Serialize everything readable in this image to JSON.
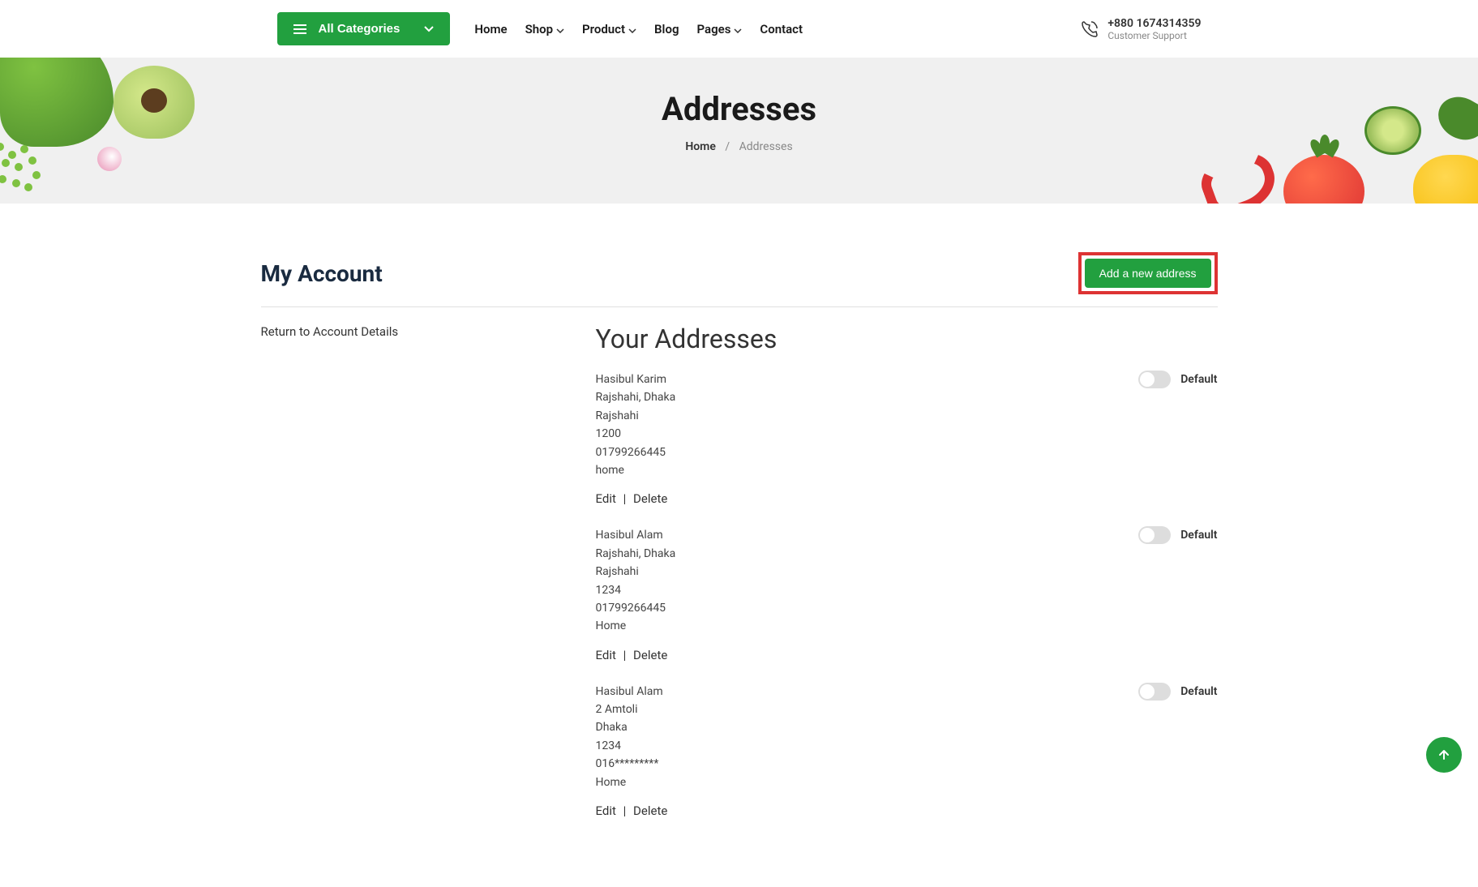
{
  "nav": {
    "categories_label": "All Categories",
    "menu": [
      {
        "label": "Home",
        "has_dropdown": false
      },
      {
        "label": "Shop",
        "has_dropdown": true
      },
      {
        "label": "Product",
        "has_dropdown": true
      },
      {
        "label": "Blog",
        "has_dropdown": false
      },
      {
        "label": "Pages",
        "has_dropdown": true
      },
      {
        "label": "Contact",
        "has_dropdown": false
      }
    ],
    "phone": "+880 1674314359",
    "support_label": "Customer Support"
  },
  "hero": {
    "title": "Addresses",
    "breadcrumb_home": "Home",
    "breadcrumb_current": "Addresses"
  },
  "account": {
    "title": "My Account",
    "add_button": "Add a new address",
    "return_link": "Return to Account Details",
    "addresses_title": "Your Addresses",
    "default_label": "Default",
    "edit_label": "Edit",
    "delete_label": "Delete",
    "addresses": [
      {
        "name": "Hasibul Karim",
        "street": "Rajshahi, Dhaka",
        "city": "Rajshahi",
        "postal": "1200",
        "phone": "01799266445",
        "type": "home"
      },
      {
        "name": "Hasibul Alam",
        "street": "Rajshahi, Dhaka",
        "city": "Rajshahi",
        "postal": "1234",
        "phone": "01799266445",
        "type": "Home"
      },
      {
        "name": "Hasibul Alam",
        "street": "2 Amtoli",
        "city": "Dhaka",
        "postal": "1234",
        "phone": "016*********",
        "type": "Home"
      }
    ]
  }
}
